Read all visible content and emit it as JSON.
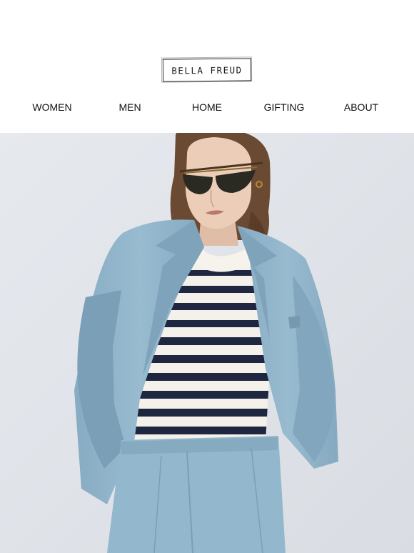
{
  "logo": {
    "text": "BELLA FREUD"
  },
  "nav": {
    "items": [
      {
        "label": "WOMEN"
      },
      {
        "label": "MEN"
      },
      {
        "label": "HOME"
      },
      {
        "label": "GIFTING"
      },
      {
        "label": "ABOUT"
      }
    ]
  },
  "hero": {
    "colors": {
      "background": "#e1e5ea",
      "blazer": "#8fb3c9",
      "stripe_dark": "#1f2640",
      "stripe_light": "#f3f1ea",
      "hair": "#6b4a33",
      "skin": "#e9cbb6"
    }
  }
}
